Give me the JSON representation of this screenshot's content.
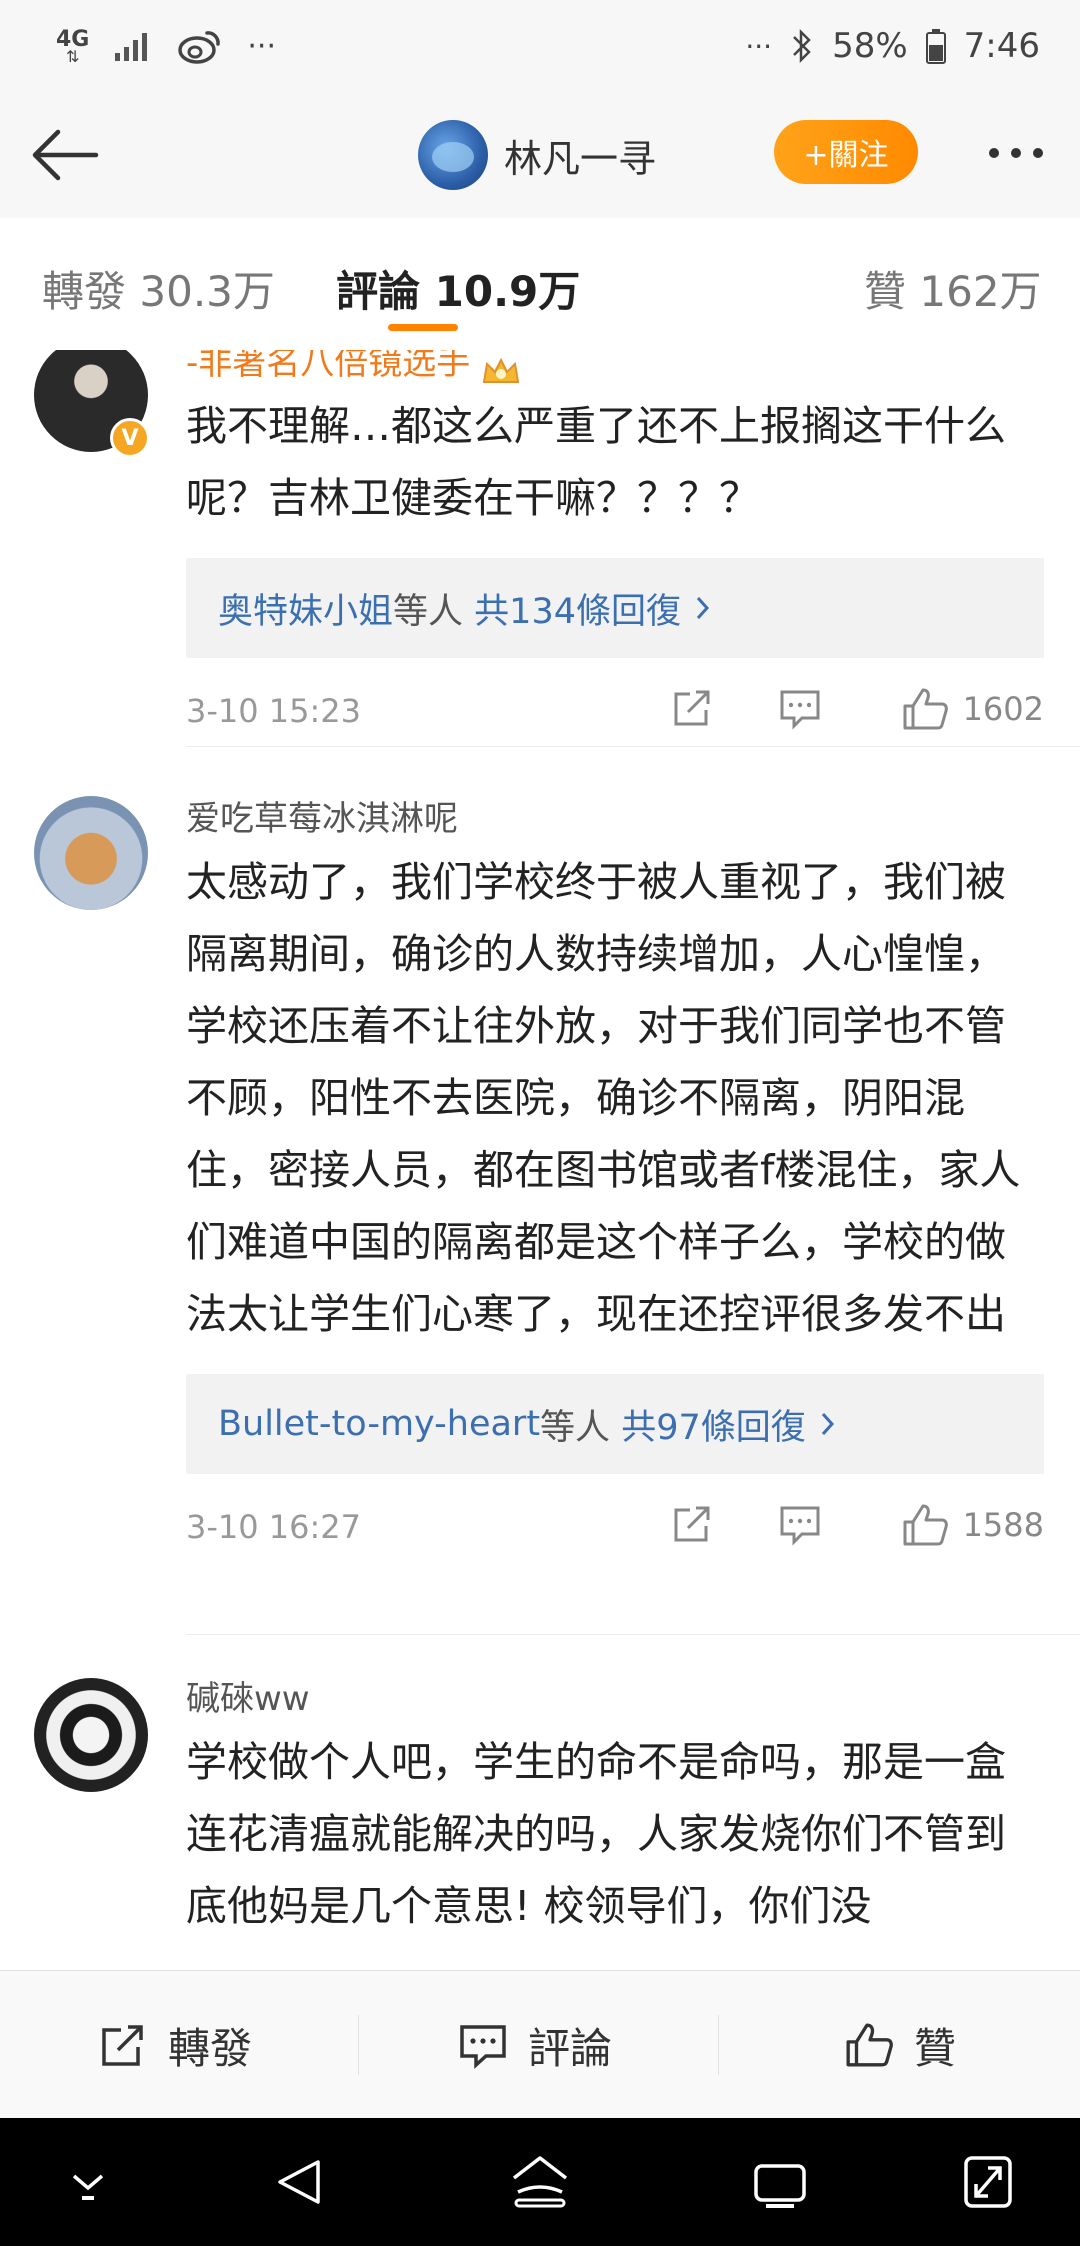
{
  "status_bar": {
    "network": "4G",
    "carrier_dots": "···",
    "right_dots": "···",
    "battery": "58%",
    "time": "7:46"
  },
  "header": {
    "username": "林凡一寻",
    "follow_label": "+關注"
  },
  "tabs": {
    "repost": {
      "label": "轉發",
      "count": "30.3万"
    },
    "comment": {
      "label": "評論",
      "count": "10.9万"
    },
    "like": {
      "label": "贊",
      "count": "162万"
    }
  },
  "comments": [
    {
      "name": "-非著名八倍镜选手",
      "verified": true,
      "text": "我不理解…都这么严重了还不上报搁这干什么呢？吉林卫健委在干嘛？？？？",
      "replies": {
        "who": "奥特妹小姐",
        "mid": "等人",
        "count": "共134條回復"
      },
      "time": "3-10 15:23",
      "likes": "1602"
    },
    {
      "name": "爱吃草莓冰淇淋呢",
      "verified": false,
      "text": "太感动了，我们学校终于被人重视了，我们被隔离期间，确诊的人数持续增加，人心惶惶，学校还压着不让往外放，对于我们同学也不管不顾，阳性不去医院，确诊不隔离，阴阳混住，密接人员，都在图书馆或者f楼混住，家人们难道中国的隔离都是这个样子么，学校的做法太让学生们心寒了，现在还控评很多发不出",
      "replies": {
        "who": "Bullet-to-my-heart",
        "mid": "等人",
        "count": "共97條回復"
      },
      "time": "3-10 16:27",
      "likes": "1588"
    },
    {
      "name": "碱䂾ww",
      "verified": false,
      "text": "学校做个人吧，学生的命不是命吗，那是一盒连花清瘟就能解决的吗，人家发烧你们不管到底他妈是几个意思! 校领导们，你们没"
    }
  ],
  "bottom_bar": {
    "repost": "轉發",
    "comment": "評論",
    "like": "贊"
  },
  "colors": {
    "accent": "#ff8200",
    "link": "#3b6fb0",
    "vip_name": "#f07b1d"
  }
}
